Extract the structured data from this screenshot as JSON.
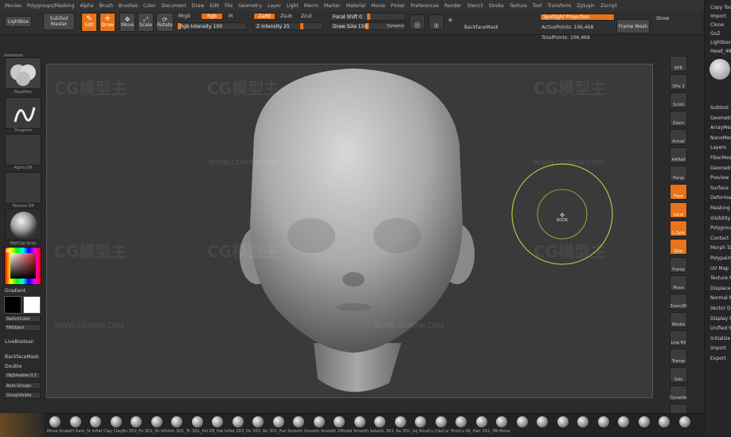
{
  "menu": [
    "Movies",
    "Polygroups/Masking",
    "Alpha",
    "Brush",
    "Brushes",
    "Color",
    "Document",
    "Draw",
    "Edit",
    "File",
    "Geometry",
    "Layer",
    "Light",
    "Macro",
    "Marker",
    "Material",
    "Movie",
    "Picker",
    "Preferences",
    "Render",
    "Stencil",
    "Stroke",
    "Texture",
    "Tool",
    "Transform",
    "Zplugin",
    "Zscript"
  ],
  "top": {
    "lightbox": "LightBox",
    "subtool_master": "SubTool Master",
    "edit": "Edit",
    "draw": "Draw",
    "move": "Move",
    "scale": "Scale",
    "rotate": "Rotate",
    "mrgb": "Mrgb",
    "rgb": "Rgb",
    "m": "M",
    "zadd": "Zadd",
    "zsub": "Zsub",
    "zcut": "Zcut",
    "rgb_intensity": "Rgb Intensity 100",
    "z_intensity": "Z Intensity 25",
    "focal_shift": "Focal Shift 0",
    "draw_size": "Draw Size 150",
    "dynamic": "Dynamic",
    "backface_mask": "BackfaceMask",
    "spotlight": "Spotlight Projection",
    "active_points": "ActivePoints: 106,468",
    "total_points": "TotalPoints: 106,468",
    "frame_mesh": "Frame Mesh",
    "show": "Show",
    "rgb_fill": 1.0,
    "z_fill": 0.25,
    "focal_fill": 0.5,
    "draw_fill": 0.3
  },
  "left": {
    "thumb1": "MaskPen",
    "thumb2": "Dragrect",
    "thumb3": "Alpha Off",
    "thumb4": "Texture Off",
    "thumb5": "MatCap Gray",
    "gradient": "Gradient",
    "switch_color": "SwitchColor",
    "fill_object": "FillObject",
    "live_boolean": "LiveBoolean",
    "backface_mask": "BackfaceMask",
    "double": "Double",
    "obj_shadow": "ObjShadow 0.3",
    "auto_groups": "Auto Groups",
    "group_visible": "GroupVisible"
  },
  "right_shelf": [
    "BPR",
    "SPix 3",
    "Scroll",
    "Zoom",
    "Actual",
    "AAHalf",
    "Persp",
    "Floor",
    "Local",
    "L.Sym",
    "Qviz",
    "Frame",
    "Move",
    "Zoom3D",
    "Rotate",
    "Line Fill",
    "Transp",
    "Solo",
    "Dynamic",
    "Xpose"
  ],
  "right_panel": {
    "top": [
      "Copy Tool",
      "Import",
      "Clone",
      "GoZ",
      "Lightbox",
      "Head_48"
    ],
    "items": [
      "Subtool",
      "Geometry",
      "ArrayMesh",
      "NanoMesh",
      "Layers",
      "FiberMesh",
      "Geometry HD",
      "Preview",
      "Surface",
      "Deformation",
      "Masking",
      "Visibility",
      "Polygroups",
      "Contact",
      "Morph Target",
      "Polypaint",
      "UV Map",
      "Texture Map",
      "Displacement",
      "Normal Map",
      "Vector Displ",
      "Display Prop",
      "Unified Skin",
      "Initialize",
      "Import",
      "Export"
    ]
  },
  "brushes": [
    "Move",
    "SnakeH",
    "Dam_St",
    "Inflat",
    "Clay",
    "ClayBu",
    "3D1_Fo",
    "3D1_Po",
    "hPolish",
    "3D1_Tri",
    "3D1_Pol",
    "3D1_Cli",
    "DE_Hai",
    "Inflat",
    "3D1_Dc",
    "3D1_Ro",
    "3D1_Ro",
    "3D1_Fun",
    "Smooth",
    "Smooth",
    "Smooth",
    "ZModel",
    "Smooth",
    "SelectL",
    "3D1_Ra",
    "3D1_Sq",
    "SliceCu",
    "ClipCur",
    "TrimCu",
    "SK_Hair",
    "3D1_3M",
    "Move"
  ],
  "brushes_label": "Move  SnakeH  Dam_St  Inflat  Clay  ClayBu  3D1_Fo  3D1_Po  hPolish  3D1_Tri  3D1_Pol  DE_Hai  Inflat  3D1_Dc  3D1_Ro  3D1_Fun  Smooth  Smooth  Smooth  ZModel  Smooth  SelectL  3D1_Ra  3D1_Sq  SliceCu  ClipCur  TrimCu  SK_Hair  3D1_3M  Move",
  "watermark": "CG模型主",
  "watermark_url": "WWW.CGMXW.COM",
  "cursor_label": "ROOK",
  "colors": {
    "accent": "#e8731a",
    "canvas": "#3a3a3a",
    "ring": "#d8d84a"
  }
}
